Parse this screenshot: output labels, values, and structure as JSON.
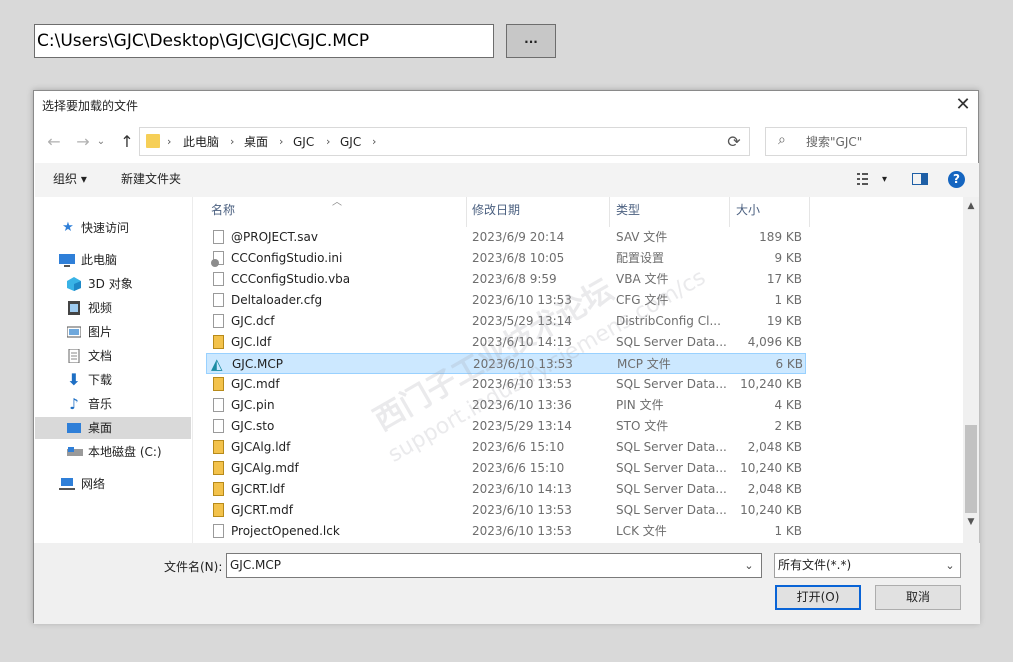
{
  "top_bar": {
    "path_value": "C:\\Users\\GJC\\Desktop\\GJC\\GJC\\GJC.MCP",
    "browse_label": "..."
  },
  "dialog": {
    "title": "选择要加载的文件",
    "close_symbol": "✕",
    "address": {
      "crumbs": [
        "此电脑",
        "桌面",
        "GJC",
        "GJC"
      ],
      "separator": "›"
    },
    "search_placeholder": "搜索\"GJC\"",
    "toolbar": {
      "organize": "组织 ▾",
      "new_folder": "新建文件夹",
      "help": "?"
    },
    "sidebar": [
      {
        "label": "快速访问",
        "icon": "star-icon"
      },
      {
        "label": "此电脑",
        "icon": "computer-icon"
      },
      {
        "label": "3D 对象",
        "icon": "cube-icon"
      },
      {
        "label": "视频",
        "icon": "video-icon"
      },
      {
        "label": "图片",
        "icon": "picture-icon"
      },
      {
        "label": "文档",
        "icon": "document-icon"
      },
      {
        "label": "下载",
        "icon": "download-icon"
      },
      {
        "label": "音乐",
        "icon": "music-icon"
      },
      {
        "label": "桌面",
        "icon": "desktop-icon",
        "selected": true
      },
      {
        "label": "本地磁盘 (C:)",
        "icon": "drive-icon"
      },
      {
        "label": "网络",
        "icon": "network-icon"
      }
    ],
    "columns": {
      "name": "名称",
      "date": "修改日期",
      "type": "类型",
      "size": "大小"
    },
    "files": [
      {
        "name": "@PROJECT.sav",
        "date": "2023/6/9 20:14",
        "type": "SAV 文件",
        "size": "189 KB",
        "icon": "doc"
      },
      {
        "name": "CCConfigStudio.ini",
        "date": "2023/6/8 10:05",
        "type": "配置设置",
        "size": "9 KB",
        "icon": "cfg"
      },
      {
        "name": "CCConfigStudio.vba",
        "date": "2023/6/8 9:59",
        "type": "VBA 文件",
        "size": "17 KB",
        "icon": "doc"
      },
      {
        "name": "Deltaloader.cfg",
        "date": "2023/6/10 13:53",
        "type": "CFG 文件",
        "size": "1 KB",
        "icon": "doc"
      },
      {
        "name": "GJC.dcf",
        "date": "2023/5/29 13:14",
        "type": "DistribConfig Cl...",
        "size": "19 KB",
        "icon": "doc"
      },
      {
        "name": "GJC.ldf",
        "date": "2023/6/10 14:13",
        "type": "SQL Server Data...",
        "size": "4,096 KB",
        "icon": "db"
      },
      {
        "name": "GJC.MCP",
        "date": "2023/6/10 13:53",
        "type": "MCP 文件",
        "size": "6 KB",
        "icon": "mcp",
        "selected": true
      },
      {
        "name": "GJC.mdf",
        "date": "2023/6/10 13:53",
        "type": "SQL Server Data...",
        "size": "10,240 KB",
        "icon": "db"
      },
      {
        "name": "GJC.pin",
        "date": "2023/6/10 13:36",
        "type": "PIN 文件",
        "size": "4 KB",
        "icon": "doc"
      },
      {
        "name": "GJC.sto",
        "date": "2023/5/29 13:14",
        "type": "STO 文件",
        "size": "2 KB",
        "icon": "doc"
      },
      {
        "name": "GJCAlg.ldf",
        "date": "2023/6/6 15:10",
        "type": "SQL Server Data...",
        "size": "2,048 KB",
        "icon": "db"
      },
      {
        "name": "GJCAlg.mdf",
        "date": "2023/6/6 15:10",
        "type": "SQL Server Data...",
        "size": "10,240 KB",
        "icon": "db"
      },
      {
        "name": "GJCRT.ldf",
        "date": "2023/6/10 14:13",
        "type": "SQL Server Data...",
        "size": "2,048 KB",
        "icon": "db"
      },
      {
        "name": "GJCRT.mdf",
        "date": "2023/6/10 13:53",
        "type": "SQL Server Data...",
        "size": "10,240 KB",
        "icon": "db"
      },
      {
        "name": "ProjectOpened.lck",
        "date": "2023/6/10 13:53",
        "type": "LCK 文件",
        "size": "1 KB",
        "icon": "doc"
      }
    ],
    "bottom": {
      "filename_label": "文件名(N):",
      "filename_value": "GJC.MCP",
      "filetype_value": "所有文件(*.*)",
      "open_label": "打开(O)",
      "cancel_label": "取消"
    },
    "watermark": {
      "line1": "西门子工业技术论坛",
      "line2": "support.industry.siemens.com/cs"
    }
  }
}
